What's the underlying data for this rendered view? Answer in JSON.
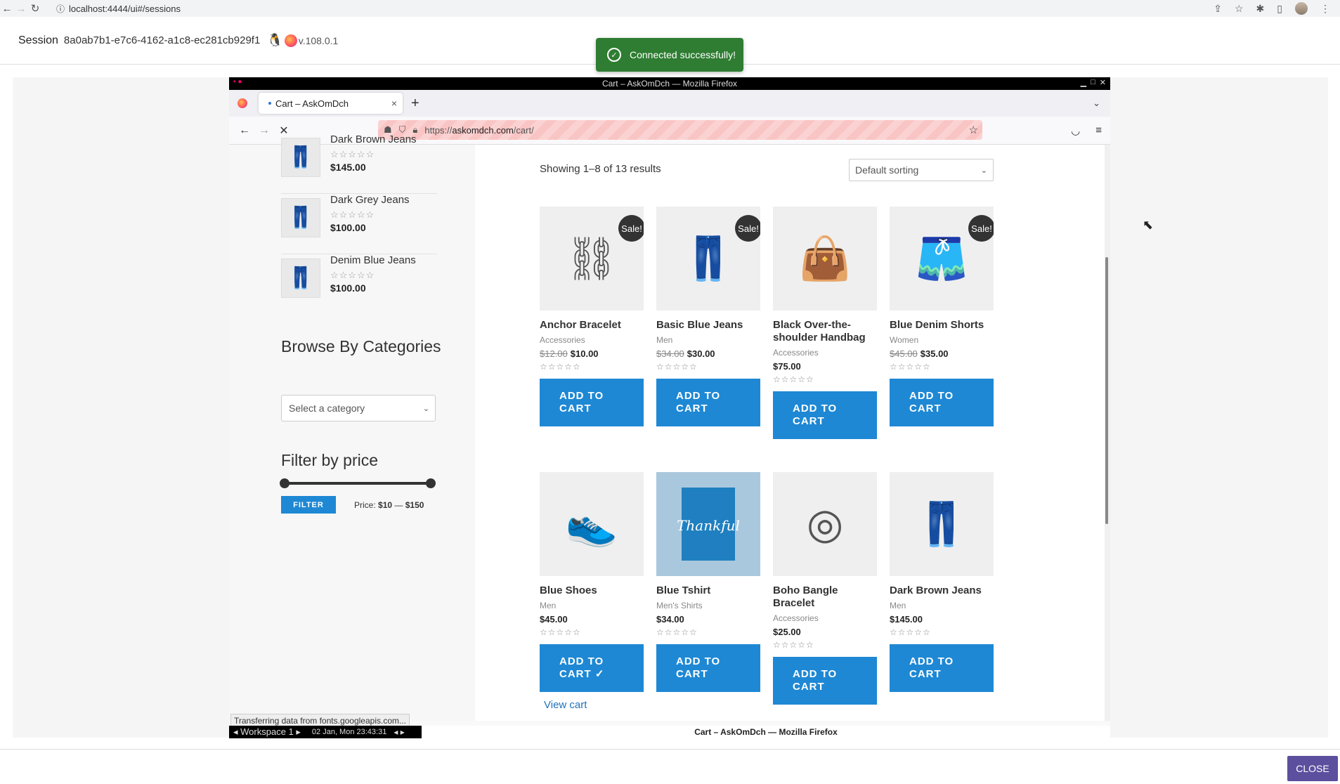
{
  "browser": {
    "url": "localhost:4444/ui#/sessions"
  },
  "session": {
    "label": "Session",
    "id": "8a0ab7b1-e7c6-4162-a1c8-ec281cb929f1",
    "version": "v.108.0.1"
  },
  "toast": {
    "text": "Connected successfully!"
  },
  "inner_window": {
    "title": "Cart – AskOmDch — Mozilla Firefox",
    "tab_label": "Cart – AskOmDch",
    "url_prefix": "https://",
    "url_host": "askomdch.com",
    "url_path": "/cart/"
  },
  "sidebar": {
    "mini_products": [
      {
        "name": "Dark Brown Jeans",
        "stars": "☆☆☆☆☆",
        "price": "$145.00"
      },
      {
        "name": "Dark Grey Jeans",
        "stars": "☆☆☆☆☆",
        "price": "$100.00"
      },
      {
        "name": "Denim Blue Jeans",
        "stars": "☆☆☆☆☆",
        "price": "$100.00"
      }
    ],
    "browse_title": "Browse By Categories",
    "category_select": "Select a category",
    "filter_title": "Filter by price",
    "filter_button": "FILTER",
    "price_label": "Price:",
    "price_min": "$10",
    "price_sep": "—",
    "price_max": "$150",
    "price_range_fraction": [
      0,
      1
    ]
  },
  "main": {
    "results": "Showing 1–8 of 13 results",
    "sorting": "Default sorting",
    "products": [
      {
        "name": "Anchor Bracelet",
        "category": "Accessories",
        "old_price": "$12.00",
        "price": "$10.00",
        "sale": "Sale!",
        "stars": "☆☆☆☆☆",
        "button": "ADD TO CART",
        "icon": "bracelet-icon"
      },
      {
        "name": "Basic Blue Jeans",
        "category": "Men",
        "old_price": "$34.00",
        "price": "$30.00",
        "sale": "Sale!",
        "stars": "☆☆☆☆☆",
        "button": "ADD TO CART",
        "icon": "jeans-icon"
      },
      {
        "name": "Black Over-the-shoulder Handbag",
        "category": "Accessories",
        "old_price": "",
        "price": "$75.00",
        "sale": "",
        "stars": "☆☆☆☆☆",
        "button": "ADD TO CART",
        "icon": "handbag-icon"
      },
      {
        "name": "Blue Denim Shorts",
        "category": "Women",
        "old_price": "$45.00",
        "price": "$35.00",
        "sale": "Sale!",
        "stars": "☆☆☆☆☆",
        "button": "ADD TO CART",
        "icon": "shorts-icon"
      },
      {
        "name": "Blue Shoes",
        "category": "Men",
        "old_price": "",
        "price": "$45.00",
        "sale": "",
        "stars": "☆☆☆☆☆",
        "button": "ADD TO CART ✓",
        "icon": "shoes-icon",
        "view_cart": "View cart"
      },
      {
        "name": "Blue Tshirt",
        "category": "Men's Shirts",
        "old_price": "",
        "price": "$34.00",
        "sale": "",
        "stars": "☆☆☆☆☆",
        "button": "ADD TO CART",
        "icon": "tshirt-icon",
        "image_text": "Thankful"
      },
      {
        "name": "Boho Bangle Bracelet",
        "category": "Accessories",
        "old_price": "",
        "price": "$25.00",
        "sale": "",
        "stars": "☆☆☆☆☆",
        "button": "ADD TO CART",
        "icon": "bangle-icon"
      },
      {
        "name": "Dark Brown Jeans",
        "category": "Men",
        "old_price": "",
        "price": "$145.00",
        "sale": "",
        "stars": "☆☆☆☆☆",
        "button": "ADD TO CART",
        "icon": "jeans-icon"
      }
    ]
  },
  "status_bar": "Transferring data from fonts.googleapis.com...",
  "taskbar": {
    "workspace": "Workspace 1",
    "datetime": "02 Jan, Mon 23:43:31",
    "window_title": "Cart – AskOmDch — Mozilla Firefox"
  },
  "close_button": "CLOSE",
  "colors": {
    "accent": "#1e88d4",
    "toast": "#2e7d32",
    "close": "#5c4f9e"
  }
}
